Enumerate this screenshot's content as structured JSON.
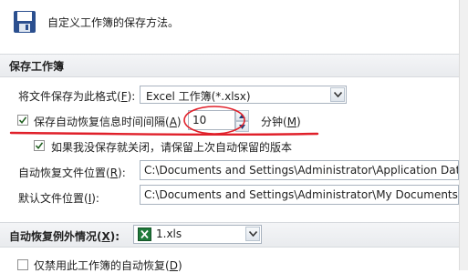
{
  "header": {
    "title": "自定义工作簿的保存方法。"
  },
  "save_workbooks": {
    "section_title": "保存工作簿",
    "format_label_pre": "将文件保存为此格式(",
    "format_label_key": "F",
    "format_label_post": "):",
    "format_value": "Excel 工作簿(*.xlsx)",
    "autorecover_label_pre": "保存自动恢复信息时间间隔(",
    "autorecover_label_key": "A",
    "autorecover_label_post": ")",
    "autorecover_checked": true,
    "autorecover_minutes": "10",
    "minutes_label_pre": "分钟(",
    "minutes_label_key": "M",
    "minutes_label_post": ")",
    "keep_last_label": "如果我没保存就关闭，请保留上次自动保留的版本",
    "keep_last_checked": true,
    "autorecover_location_label_pre": "自动恢复文件位置(",
    "autorecover_location_label_key": "R",
    "autorecover_location_label_post": "):",
    "autorecover_location_value": "C:\\Documents and Settings\\Administrator\\Application Data\\",
    "default_location_label_pre": "默认文件位置(",
    "default_location_label_key": "I",
    "default_location_label_post": "):",
    "default_location_value": "C:\\Documents and Settings\\Administrator\\My Documents"
  },
  "autorecover_exceptions": {
    "label_pre": "自动恢复例外情况(",
    "label_key": "X",
    "label_post": "):",
    "workbook_value": "1.xls",
    "disable_label_pre": "仅禁用此工作簿的自动恢复(",
    "disable_label_key": "D",
    "disable_label_post": ")",
    "disable_checked": false
  },
  "annotation": {
    "color": "#e0202a"
  }
}
